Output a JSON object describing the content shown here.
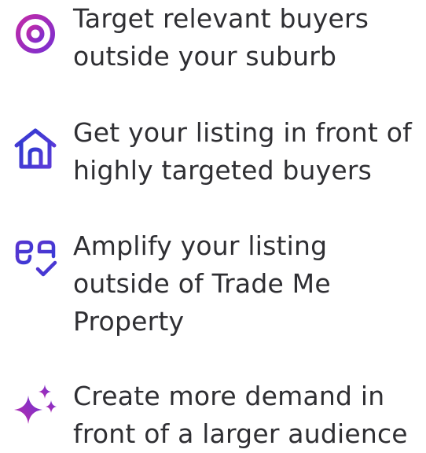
{
  "features": [
    {
      "icon": "target-icon",
      "lines": [
        "Target relevant buyers",
        "outside your suburb"
      ]
    },
    {
      "icon": "house-icon",
      "lines": [
        "Get your listing in front of",
        "highly targeted buyers"
      ]
    },
    {
      "icon": "amplify-check-icon",
      "lines": [
        "Amplify your listing",
        "outside of Trade Me",
        "Property"
      ]
    },
    {
      "icon": "sparkle-icon",
      "lines": [
        "Create more demand in",
        "front of a larger audience"
      ]
    }
  ],
  "colors": {
    "text": "#2f2f33",
    "gradient_start": "#3b3bd6",
    "gradient_end": "#c02aa8"
  }
}
